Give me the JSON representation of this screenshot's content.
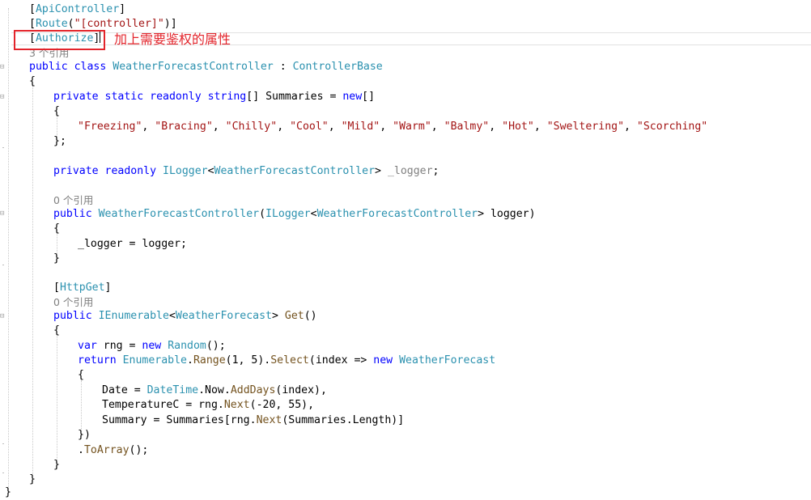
{
  "annotation": {
    "text": "加上需要鉴权的属性",
    "color": "#e3242b"
  },
  "colors": {
    "keyword": "#0000ff",
    "type": "#2b91af",
    "string": "#a31515",
    "method": "#74531f",
    "reference_lens": "#808080"
  },
  "code": {
    "l1": {
      "open": "[",
      "attr": "ApiController",
      "close": "]"
    },
    "l2": {
      "open": "[",
      "attr": "Route",
      "paren_open": "(",
      "str": "\"[controller]\"",
      "tail": ")]"
    },
    "l3": {
      "open": "[",
      "attr": "Authorize",
      "close": "]"
    },
    "l4": {
      "lens": "3 个引用"
    },
    "l5": {
      "kw1": "public",
      "kw2": "class",
      "type": "WeatherForecastController",
      "colon": " : ",
      "base": "ControllerBase"
    },
    "l6": {
      "text": "{"
    },
    "l7": {
      "kw1": "private",
      "kw2": "static",
      "kw3": "readonly",
      "kw4": "string",
      "mid": "[] Summaries = ",
      "kw5": "new",
      "end": "[]"
    },
    "l8": {
      "text": "{"
    },
    "l9": {
      "s1": "\"Freezing\"",
      "s2": "\"Bracing\"",
      "s3": "\"Chilly\"",
      "s4": "\"Cool\"",
      "s5": "\"Mild\"",
      "s6": "\"Warm\"",
      "s7": "\"Balmy\"",
      "s8": "\"Hot\"",
      "s9": "\"Sweltering\"",
      "s10": "\"Scorching\"",
      "sep": ", "
    },
    "l10": {
      "text": "};"
    },
    "l11": {
      "kw1": "private",
      "kw2": "readonly",
      "type1": "ILogger",
      "lt": "<",
      "type2": "WeatherForecastController",
      "gt": "> ",
      "field": "_logger",
      "end": ";"
    },
    "l12": {
      "lens": "0 个引用"
    },
    "l13": {
      "kw": "public",
      "ctor": "WeatherForecastController",
      "p1": "(",
      "type1": "ILogger",
      "lt": "<",
      "type2": "WeatherForecastController",
      "gt": "> logger)"
    },
    "l14": {
      "text": "{"
    },
    "l15": {
      "a": "_logger = logger;"
    },
    "l16": {
      "text": "}"
    },
    "l17": {
      "open": "[",
      "attr": "HttpGet",
      "close": "]"
    },
    "l18": {
      "lens": "0 个引用"
    },
    "l19": {
      "kw": "public",
      "type1": "IEnumerable",
      "lt": "<",
      "type2": "WeatherForecast",
      "gt": "> ",
      "method": "Get",
      "end": "()"
    },
    "l20": {
      "text": "{"
    },
    "l21": {
      "kw1": "var",
      "mid": " rng = ",
      "kw2": "new",
      "type": "Random",
      "end": "();"
    },
    "l22": {
      "kw1": "return",
      "type": "Enumerable",
      "dot": ".",
      "m1": "Range",
      "args": "(1, 5).",
      "m2": "Select",
      "lam": "(index => ",
      "kw2": "new",
      "type2": "WeatherForecast"
    },
    "l23": {
      "text": "{"
    },
    "l24": {
      "a": "Date = ",
      "type": "DateTime",
      "b": ".Now.",
      "m": "AddDays",
      "c": "(index),"
    },
    "l25": {
      "a": "TemperatureC = rng.",
      "m": "Next",
      "c": "(-20, 55),"
    },
    "l26": {
      "a": "Summary = Summaries[rng.",
      "m": "Next",
      "c": "(Summaries.Length)]"
    },
    "l27": {
      "text": "})"
    },
    "l28": {
      "dot": ".",
      "m": "ToArray",
      "end": "();"
    },
    "l29": {
      "text": "}"
    },
    "l30": {
      "text": "}"
    },
    "l31": {
      "text": "}"
    }
  }
}
